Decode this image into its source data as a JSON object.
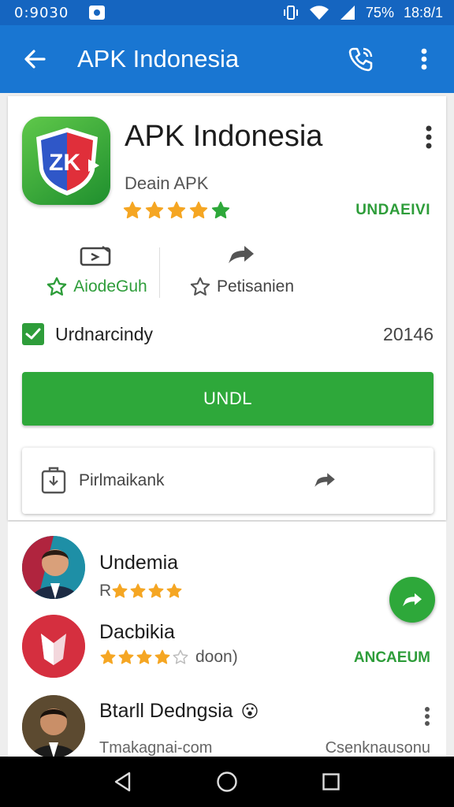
{
  "status_bar": {
    "time": "0:9030",
    "battery": "75%",
    "clock": "18:8/1"
  },
  "app_bar": {
    "title": "APK Indonesia"
  },
  "app": {
    "name": "APK Indonesia",
    "developer": "Deain APK",
    "rating": 4,
    "rating_max": 5,
    "install_tag": "UNDAEIVI"
  },
  "stats": [
    {
      "label": "AiodeGuh",
      "icon": "download-card-icon"
    },
    {
      "label": "Petisanien",
      "icon": "share-icon"
    }
  ],
  "checkbox": {
    "label": "Urdnarcindy",
    "value": "20146",
    "checked": true
  },
  "install_button": {
    "label": "UNDL"
  },
  "permission": {
    "label": "Pirlmaikank"
  },
  "list": [
    {
      "title": "Undemia",
      "sub_prefix": "R",
      "rating": 4
    },
    {
      "title": "Dacbikia",
      "rating": 4,
      "sub_suffix": "doon)",
      "action": "ANCAEUM"
    },
    {
      "title": "Btarll Dedngsia",
      "emoji": "😮",
      "footer_left": "Tmakagnai-com",
      "footer_right": "Csenknausonu"
    }
  ],
  "colors": {
    "app_bar": "#1976d2",
    "status_bar": "#1565c0",
    "accent_green": "#2ea83a",
    "star": "#f5a623"
  }
}
